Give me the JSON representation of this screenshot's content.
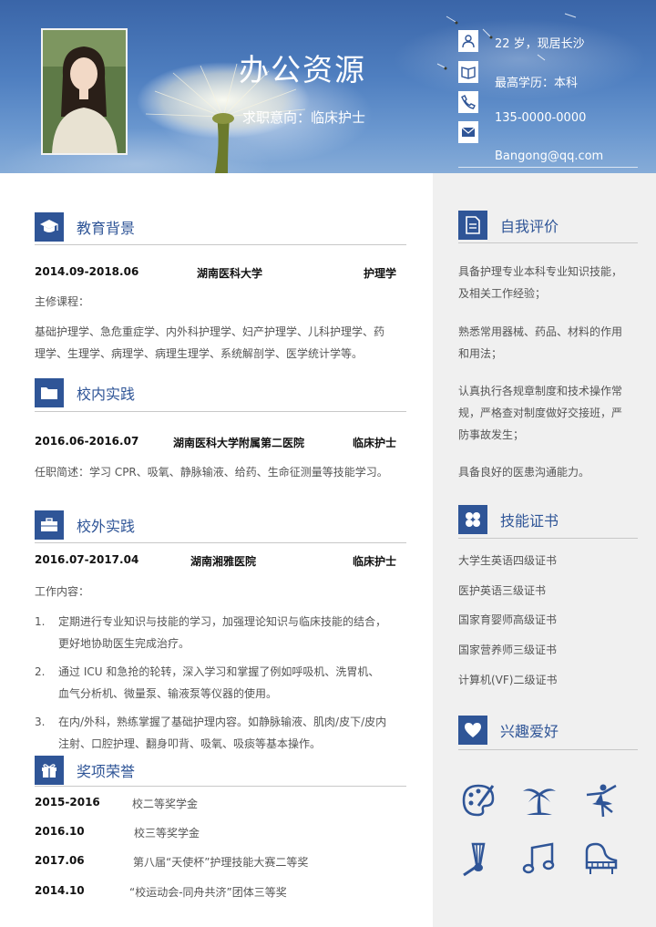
{
  "header": {
    "name": "办公资源",
    "intent": "求职意向：临床护士",
    "contacts": [
      {
        "icon": "person-icon",
        "text": "22 岁，现居长沙"
      },
      {
        "icon": "book-icon",
        "text": "最高学历：本科"
      },
      {
        "icon": "phone-icon",
        "text": "135-0000-0000"
      },
      {
        "icon": "mail-icon",
        "text": "Bangong@qq.com"
      }
    ]
  },
  "education": {
    "title": "教育背景",
    "period": "2014.09-2018.06",
    "school": "湖南医科大学",
    "major": "护理学",
    "courses_label": "主修课程：",
    "courses_line1": "基础护理学、急危重症学、内外科护理学、妇产护理学、儿科护理学、药",
    "courses_line2": "理学、生理学、病理学、病理生理学、系统解剖学、医学统计学等。"
  },
  "campus": {
    "title": "校内实践",
    "period": "2016.06-2016.07",
    "org": "湖南医科大学附属第二医院",
    "role": "临床护士",
    "desc": "任职简述：学习 CPR、吸氧、静脉输液、给药、生命征测量等技能学习。"
  },
  "external": {
    "title": "校外实践",
    "period": "2016.07-2017.04",
    "org": "湖南湘雅医院",
    "role": "临床护士",
    "label": "工作内容：",
    "items": [
      {
        "num": "1.",
        "line1": "定期进行专业知识与技能的学习，加强理论知识与临床技能的结合，",
        "line2": "更好地协助医生完成治疗。"
      },
      {
        "num": "2.",
        "line1": "通过 ICU 和急抢的轮转，深入学习和掌握了例如呼吸机、洗胃机、",
        "line2": "血气分析机、微量泵、输液泵等仪器的使用。"
      },
      {
        "num": "3.",
        "line1": "在内/外科，熟练掌握了基础护理内容。如静脉输液、肌肉/皮下/皮内",
        "line2": "注射、口腔护理、翻身叩背、吸氧、吸痰等基本操作。"
      }
    ]
  },
  "awards": {
    "title": "奖项荣誉",
    "items": [
      {
        "year": "2015-2016",
        "text": "校二等奖学金"
      },
      {
        "year": "2016.10",
        "text": "校三等奖学金"
      },
      {
        "year": "2017.06",
        "text": "第八届“天使杯”护理技能大赛二等奖"
      },
      {
        "year": "2014.10",
        "text": "“校运动会-同舟共济”团体三等奖"
      }
    ]
  },
  "self_eval": {
    "title": "自我评价",
    "p1_l1": "具备护理专业本科专业知识技能，",
    "p1_l2": "及相关工作经验；",
    "p2_l1": "熟悉常用器械、药品、材料的作用",
    "p2_l2": "和用法；",
    "p3_l1": "认真执行各规章制度和技术操作常",
    "p3_l2": "规，严格查对制度做好交接班，严",
    "p3_l3": "防事故发生；",
    "p4_l1": "具备良好的医患沟通能力。"
  },
  "skills": {
    "title": "技能证书",
    "items": [
      "大学生英语四级证书",
      "医护英语三级证书",
      "国家育婴师高级证书",
      "国家营养师三级证书",
      "计算机(VF)二级证书"
    ]
  },
  "hobbies": {
    "title": "兴趣爱好",
    "icons": [
      "palette-icon",
      "palm-tree-icon",
      "dancer-icon",
      "badminton-icon",
      "music-note-icon",
      "piano-icon"
    ]
  },
  "colors": {
    "accent": "#2f5597",
    "right_bg": "#f0f0f0"
  }
}
